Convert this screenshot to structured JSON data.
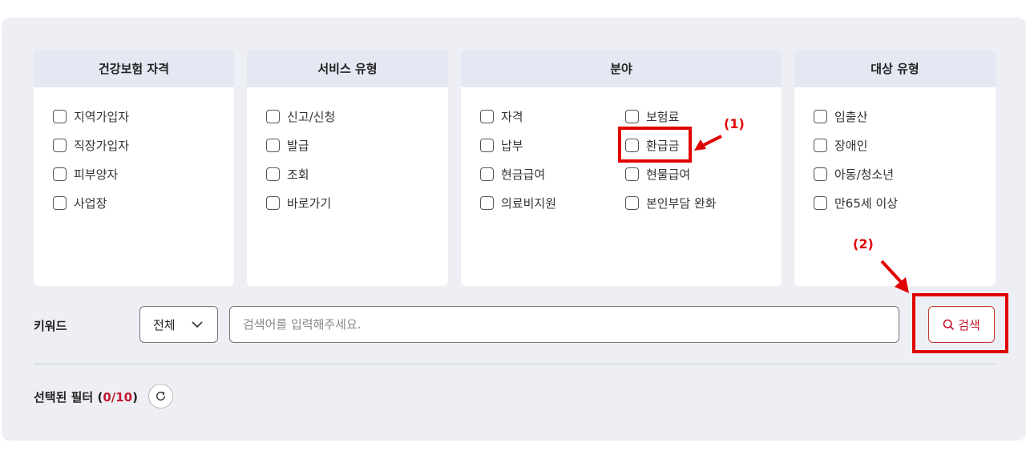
{
  "filters": {
    "insurance": {
      "title": "건강보험 자격",
      "options": [
        "지역가입자",
        "직장가입자",
        "피부양자",
        "사업장"
      ]
    },
    "service": {
      "title": "서비스 유형",
      "options": [
        "신고/신청",
        "발급",
        "조회",
        "바로가기"
      ]
    },
    "field": {
      "title": "분야",
      "options": [
        "자격",
        "납부",
        "현금급여",
        "의료비지원",
        "보험료",
        "환급금",
        "현물급여",
        "본인부담 완화"
      ]
    },
    "target": {
      "title": "대상 유형",
      "options": [
        "임출산",
        "장애인",
        "아동/청소년",
        "만65세 이상"
      ]
    }
  },
  "keyword": {
    "label": "키워드",
    "scope_value": "전체",
    "placeholder": "검색어를 입력해주세요.",
    "search_label": "검색"
  },
  "selected": {
    "label_prefix": "선택된 필터 (",
    "count": "0/10",
    "label_suffix": ")"
  },
  "annotations": {
    "first": "(1)",
    "second": "(2)",
    "color": "#e00000"
  }
}
